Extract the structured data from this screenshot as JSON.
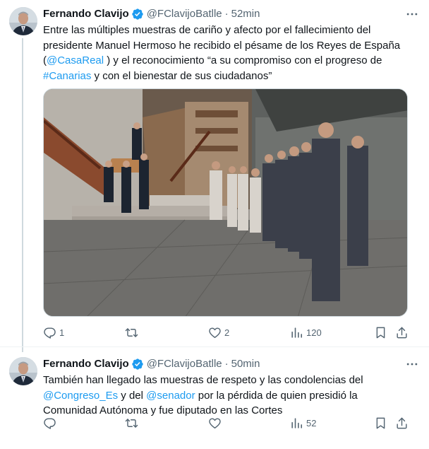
{
  "tweets": [
    {
      "author_name": "Fernando Clavijo",
      "handle": "@FClavijoBatlle",
      "dot": "·",
      "time": "52min",
      "text_parts": {
        "p1": "Entre las múltiples muestras de cariño y afecto por el fallecimiento del presidente Manuel Hermoso he recibido el pésame de los Reyes de España (",
        "mention1": "@CasaReal",
        "p2": " ) y el reconocimiento “a su compromiso con el progreso de ",
        "hashtag1": "#Canarias",
        "p3": " y con el bienestar de sus ciudadanos”"
      },
      "media_icon": "photo-funeral-coffin-procession",
      "stats": {
        "replies": "1",
        "retweets": "",
        "likes": "2",
        "views": "120"
      }
    },
    {
      "author_name": "Fernando Clavijo",
      "handle": "@FClavijoBatlle",
      "dot": "·",
      "time": "50min",
      "text_parts": {
        "p1": "También han llegado las muestras de respeto y las condolencias del ",
        "mention1": "@Congreso_Es",
        "p2": " y del ",
        "mention2": "@senador",
        "p3": " por la pérdida de quien presidió la Comunidad Autónoma y fue diputado en las Cortes"
      },
      "stats": {
        "replies": "",
        "retweets": "",
        "likes": "",
        "views": "52"
      }
    }
  ],
  "icons": {
    "verified": "verified-badge-icon",
    "more": "more-options-icon",
    "reply": "reply-icon",
    "retweet": "retweet-icon",
    "like": "heart-icon",
    "views": "views-chart-icon",
    "bookmark": "bookmark-icon",
    "share": "share-icon"
  },
  "colors": {
    "link": "#1d9bf0",
    "secondary_text": "#536471",
    "primary_text": "#0f1419",
    "verified": "#1d9bf0",
    "thread_line": "#cfd9de"
  }
}
